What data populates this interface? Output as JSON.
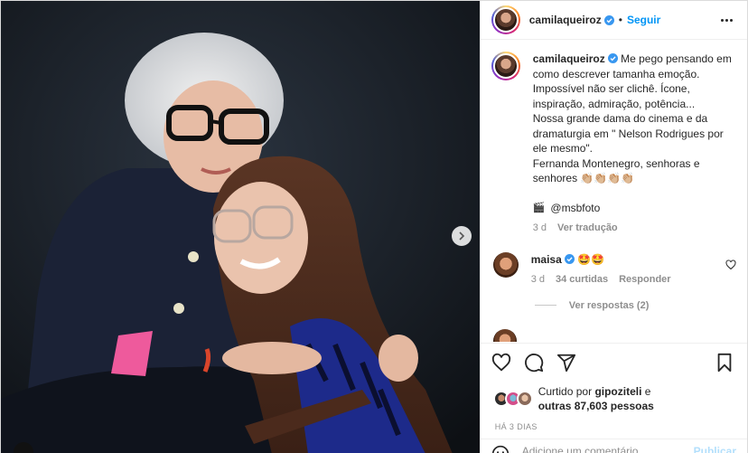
{
  "post": {
    "username": "camilaqueiroz",
    "follow_label": "Seguir",
    "dot": "•"
  },
  "caption": {
    "text": "Me pego pensando em como descrever tamanha emoção. Impossível não ser clichê. Ícone, inspiração, admiração, potência...\nNossa grande dama do cinema e da dramaturgia em \" Nelson Rodrigues por ele mesmo\".\nFernanda Montenegro, senhoras e senhores 👏🏼👏🏼👏🏼👏🏼",
    "credit_icon": "🎬",
    "credit": "@msbfoto",
    "time": "3 d",
    "translate_label": "Ver tradução"
  },
  "comment": {
    "username": "maisa",
    "text": "🤩🤩",
    "time": "3 d",
    "likes": "34 curtidas",
    "reply_label": "Responder",
    "view_replies": "Ver respostas (2)"
  },
  "likes": {
    "prefix": "Curtido por",
    "user": "gipoziteli",
    "and": "e",
    "others": "outras 87,603 pessoas"
  },
  "time_ago": "HÁ 3 DIAS",
  "add_comment": {
    "placeholder": "Adicione um comentário...",
    "publish_label": "Publicar"
  },
  "colors": {
    "accent": "#0095f6",
    "verified": "#3897f0",
    "muted": "#8e8e8e"
  }
}
